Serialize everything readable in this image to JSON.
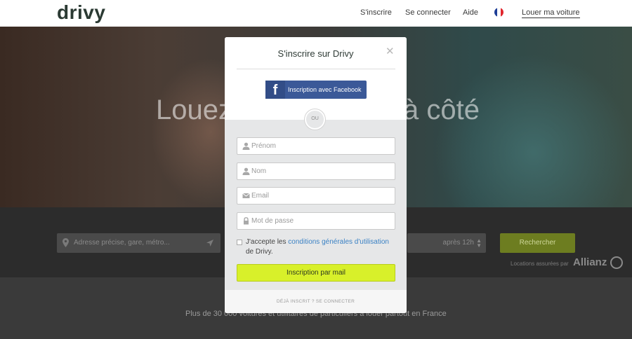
{
  "header": {
    "logo": "drivy",
    "nav": {
      "signup": "S'inscrire",
      "login": "Se connecter",
      "help": "Aide",
      "rent": "Louer ma voiture"
    },
    "flag_colors": [
      "#1d3e97",
      "#ffffff",
      "#e1262d"
    ]
  },
  "hero": {
    "title_left": "Louez",
    "title_right": "à côté",
    "search": {
      "address_placeholder": "Adresse précise, gare, métro...",
      "time_value": "après 12h",
      "button": "Rechercher"
    },
    "insured_by": "Locations assurées par",
    "insurer": "Allianz"
  },
  "lower": {
    "text": "Plus de 30 000 voitures et utilitaires de particuliers à louer partout en France"
  },
  "modal": {
    "title": "S'inscrire sur Drivy",
    "close_icon": "close-icon",
    "facebook_button": "Inscription avec Facebook",
    "or": "OU",
    "fields": {
      "first_name": "Prénom",
      "last_name": "Nom",
      "email": "Email",
      "password": "Mot de passe"
    },
    "terms": {
      "prefix": "J'accepte les ",
      "link": "conditions générales d'utilisation",
      "suffix": " de Drivy."
    },
    "submit": "Inscription par mail",
    "footer": "DÉJÀ INSCRIT ? SE CONNECTER"
  },
  "colors": {
    "accent_green": "#d8f02a",
    "facebook_blue": "#3b5998",
    "link_blue": "#3b82c4"
  }
}
